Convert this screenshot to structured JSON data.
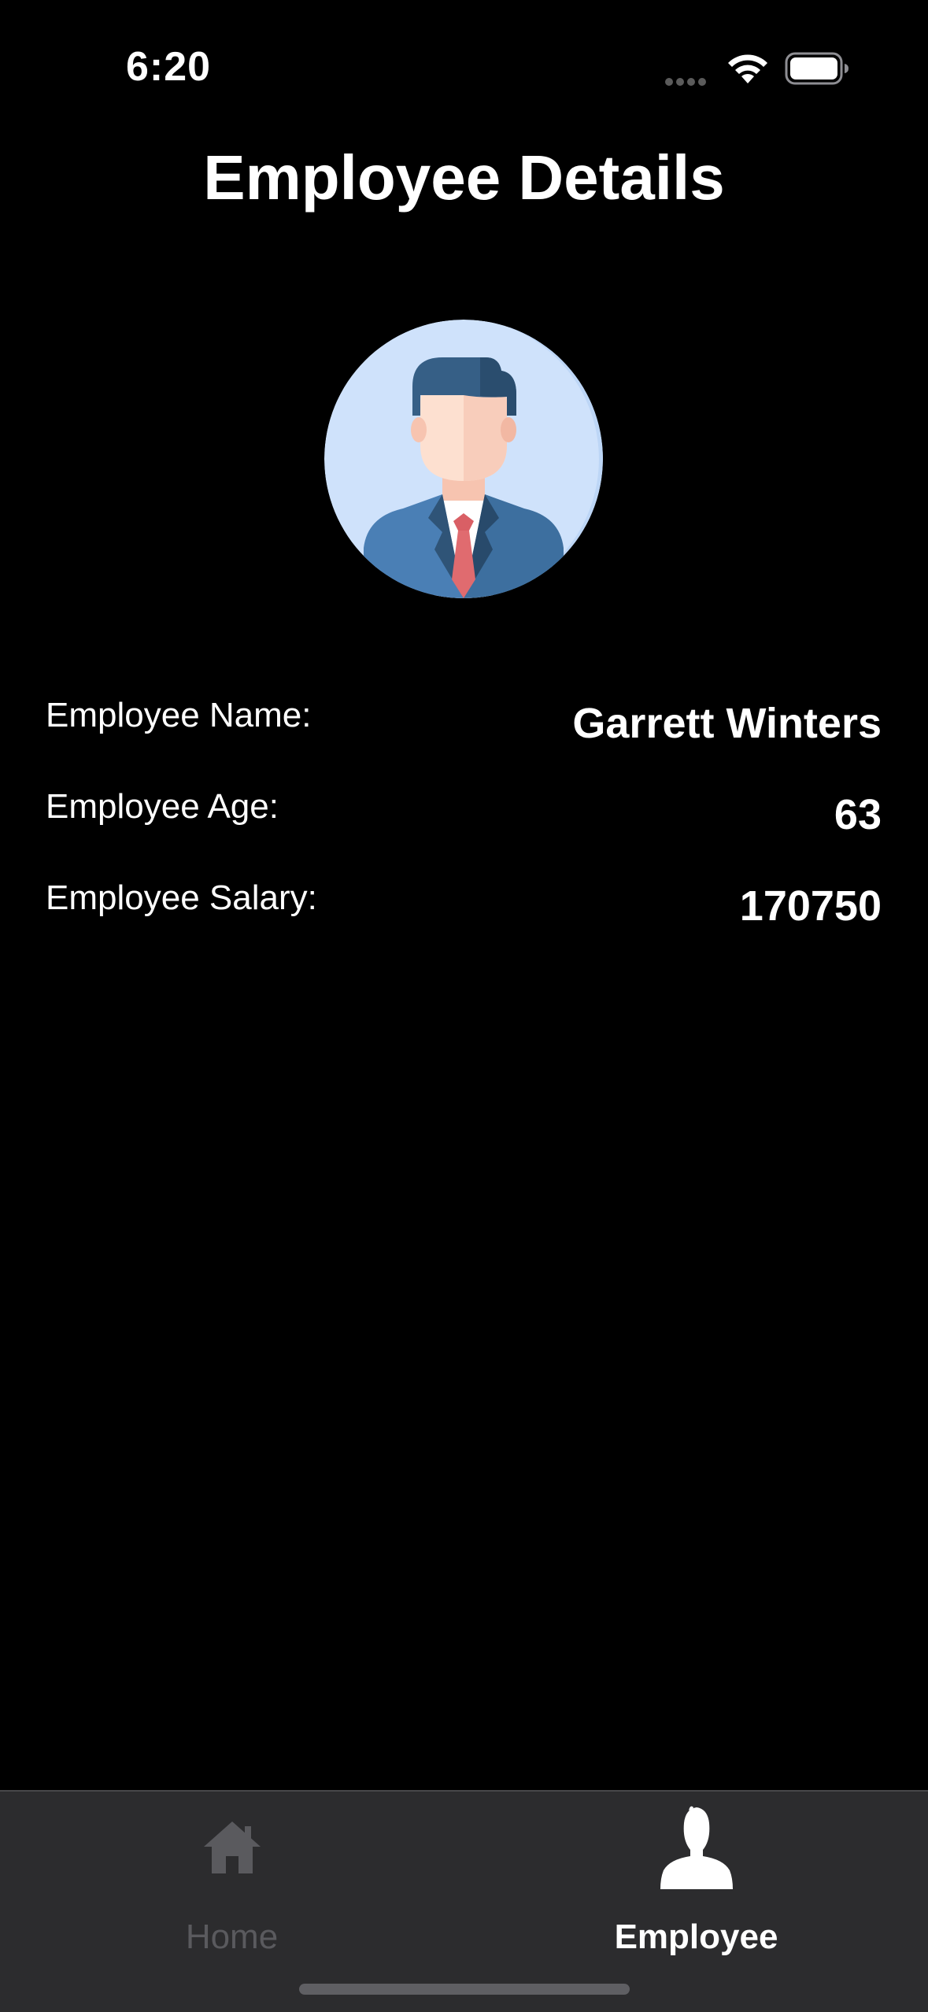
{
  "status_bar": {
    "time": "6:20"
  },
  "page": {
    "title": "Employee Details"
  },
  "employee": {
    "name_label": "Employee Name:",
    "name_value": "Garrett Winters",
    "age_label": "Employee Age:",
    "age_value": "63",
    "salary_label": "Employee Salary:",
    "salary_value": "170750"
  },
  "tab_bar": {
    "tabs": [
      {
        "label": "Home",
        "icon": "house-icon",
        "selected": false
      },
      {
        "label": "Employee",
        "icon": "person-icon",
        "selected": true
      }
    ]
  },
  "colors": {
    "background": "#000000",
    "tab_bar_background": "#2c2c2e",
    "tab_inactive": "#5a5a5e",
    "tab_active": "#ffffff",
    "avatar_background": "#cfe2fb",
    "suit": "#4a7fb5",
    "tie": "#e06b6f",
    "hair": "#2f5477",
    "skin": "#fde0d0"
  }
}
